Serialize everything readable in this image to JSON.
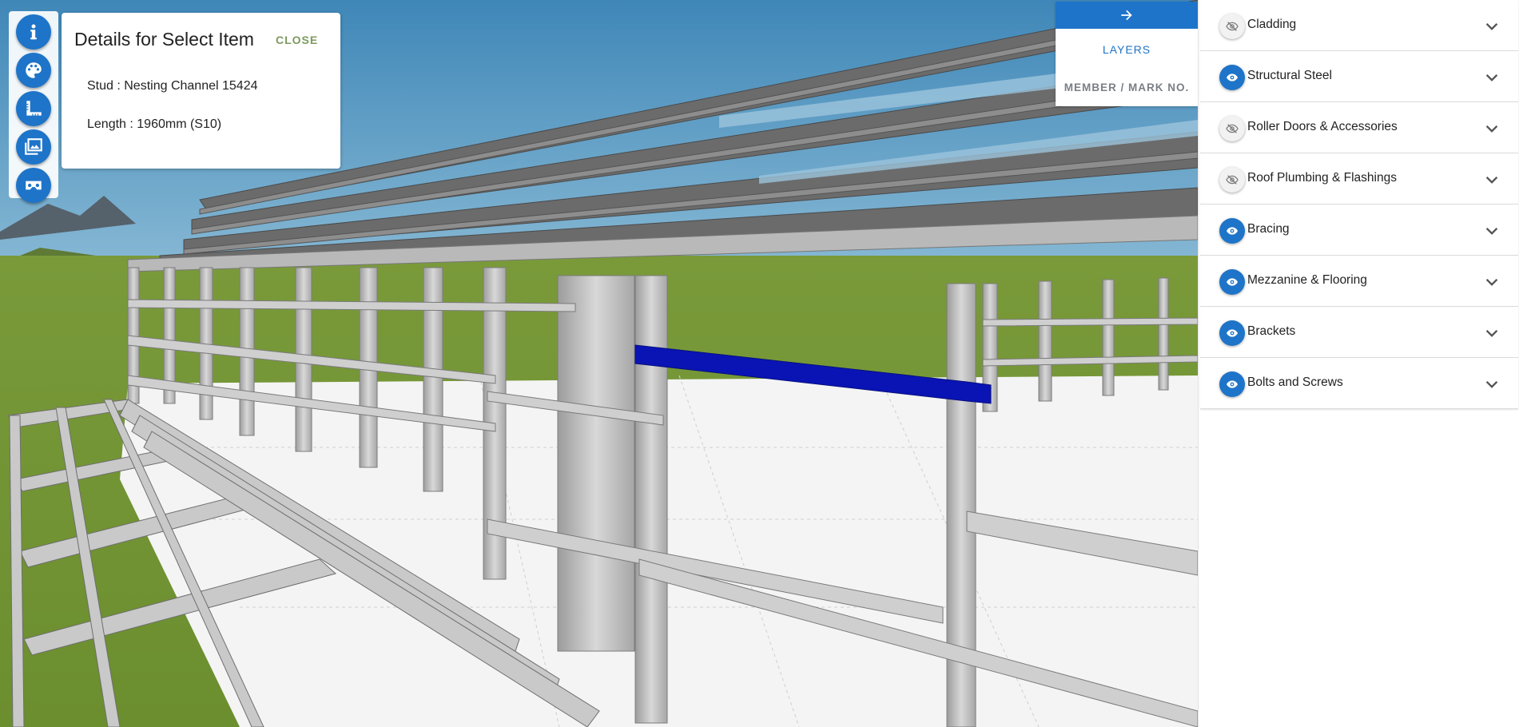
{
  "details": {
    "title": "Details for Select Item",
    "close_label": "CLOSE",
    "lines": [
      "Stud : Nesting Channel 15424",
      "Length : 1960mm (S10)"
    ]
  },
  "toolbar": {
    "buttons": [
      "info-icon",
      "palette-icon",
      "measure-icon",
      "gallery-icon",
      "vr-headset-icon"
    ]
  },
  "view_tabs": {
    "toggle_icon": "arrow-right-icon",
    "tabs": [
      "LAYERS",
      "MEMBER / MARK NO."
    ],
    "active": "LAYERS"
  },
  "layers": [
    {
      "label": "Cladding",
      "visible": false
    },
    {
      "label": "Structural Steel",
      "visible": true
    },
    {
      "label": "Roller Doors & Accessories",
      "visible": false
    },
    {
      "label": "Roof Plumbing & Flashings",
      "visible": false
    },
    {
      "label": "Bracing",
      "visible": true
    },
    {
      "label": "Mezzanine & Flooring",
      "visible": true
    },
    {
      "label": "Brackets",
      "visible": true
    },
    {
      "label": "Bolts and Screws",
      "visible": true
    }
  ],
  "colors": {
    "accent": "#1e74c8",
    "selected_member": "#0a14b4",
    "close_text": "#7d9a5e"
  }
}
